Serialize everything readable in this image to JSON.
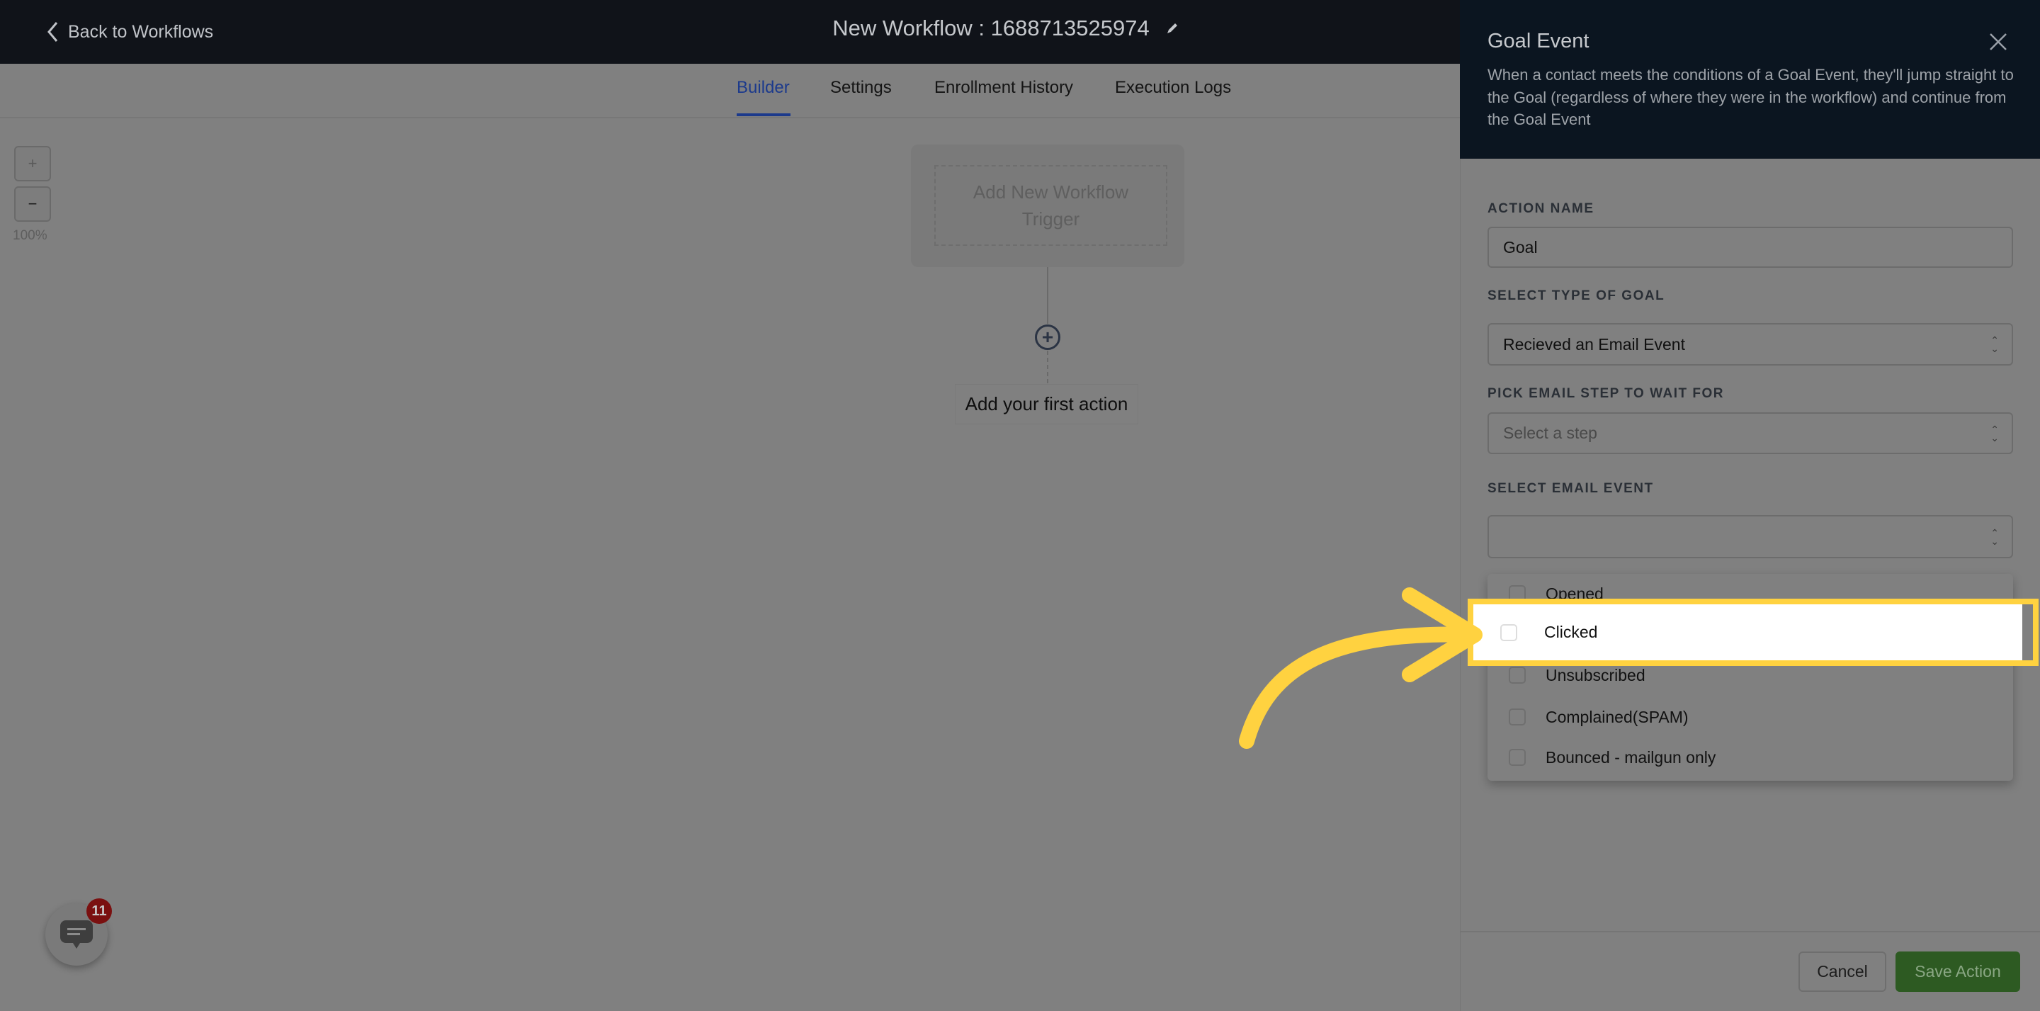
{
  "topbar": {
    "back_label": "Back to Workflows",
    "workflow_title": "New Workflow : 1688713525974"
  },
  "tabs": [
    {
      "label": "Builder",
      "active": true
    },
    {
      "label": "Settings"
    },
    {
      "label": "Enrollment History"
    },
    {
      "label": "Execution Logs"
    }
  ],
  "zoom": {
    "in_label": "+",
    "out_label": "−",
    "level": "100%"
  },
  "canvas": {
    "trigger_label": "Add New Workflow Trigger",
    "first_action_label": "Add your first action"
  },
  "chat": {
    "badge_count": "11"
  },
  "panel": {
    "title": "Goal Event",
    "description": "When a contact meets the conditions of a Goal Event, they'll jump straight to the Goal (regardless of where they were in the workflow) and continue from the Goal Event",
    "action_name_label": "ACTION NAME",
    "action_name_value": "Goal",
    "goal_type_label": "SELECT TYPE OF GOAL",
    "goal_type_value": "Recieved an Email Event",
    "email_step_label": "PICK EMAIL STEP TO WAIT FOR",
    "email_step_placeholder": "Select a step",
    "email_event_label": "SELECT EMAIL EVENT",
    "email_event_value": "",
    "email_event_options": [
      "Opened",
      "Clicked",
      "Unsubscribed",
      "Complained(SPAM)",
      "Bounced - mailgun only"
    ],
    "highlighted_option": "Clicked",
    "cancel_label": "Cancel",
    "save_label": "Save Action"
  },
  "colors": {
    "highlight": "#ffd240",
    "save_button": "#5aa843",
    "active_tab": "#1c3a8c",
    "overlay_dim": "rgba(0,0,0,0.5)"
  }
}
